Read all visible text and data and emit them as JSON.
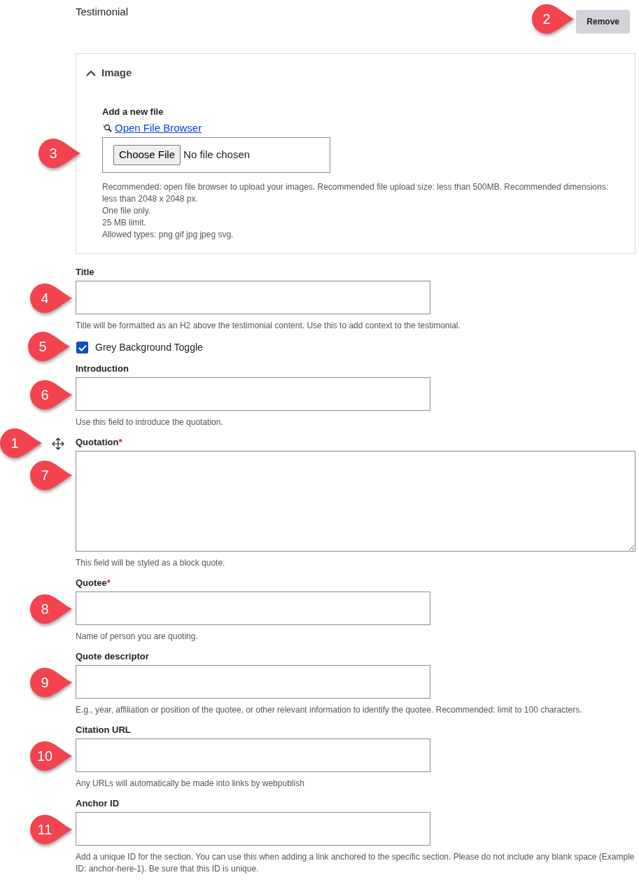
{
  "heading": "Testimonial",
  "remove_button": {
    "label": "Remove",
    "callout": "2"
  },
  "image_section": {
    "title": "Image",
    "expanded": true,
    "add_label": "Add a new file",
    "browser_link": "Open File Browser",
    "choose_button": "Choose File",
    "file_status": "No file chosen",
    "callout": "3",
    "help_lines": [
      "Recommended: open file browser to upload your images. Recommended file upload size: less than 500MB. Recommended dimensions: less than 2048 x 2048 px.",
      "One file only.",
      "25 MB limit.",
      "Allowed types: png gif jpg jpeg svg."
    ]
  },
  "fields": [
    {
      "kind": "text",
      "label": "Title",
      "callout": "4",
      "help": "Title will be formatted as an H2 above the testimonial content. Use this to add context to the testimonial."
    },
    {
      "kind": "checkbox",
      "label": "Grey Background Toggle",
      "checked": true,
      "callout": "5"
    },
    {
      "kind": "text",
      "label": "Introduction",
      "callout": "6",
      "help": "Use this field to introduce the quotation."
    },
    {
      "kind": "textarea",
      "label": "Quotation",
      "required_mark": "*",
      "callout": "7",
      "drag_callout": "1",
      "help": "This field will be styled as a block quote."
    },
    {
      "kind": "text",
      "label": "Quotee",
      "required_mark": "*",
      "callout": "8",
      "help": "Name of person you are quoting."
    },
    {
      "kind": "text",
      "label": "Quote descriptor",
      "callout": "9",
      "help": "E.g., year, affiliation or position of the quotee, or other relevant information to identify the quotee. Recommended: limit to 100 characters."
    },
    {
      "kind": "text",
      "label": "Citation URL",
      "callout": "10",
      "help": "Any URLs will automatically be made into links by webpublish"
    },
    {
      "kind": "text",
      "label": "Anchor ID",
      "callout": "11",
      "help": "Add a unique ID for the section. You can use this when adding a link anchored to the specific section. Please do not include any blank space (Example ID: anchor-here-1). Be sure that this ID is unique."
    }
  ]
}
